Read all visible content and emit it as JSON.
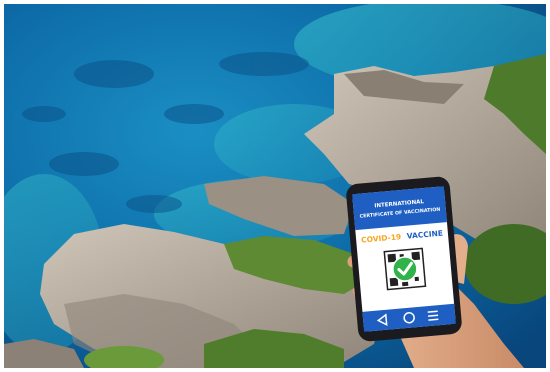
{
  "scene": {
    "sea_deep_color": "#0a4f86",
    "sea_shallow_color": "#2fb5c8",
    "rock_color": "#b8ada0",
    "vegetation_color": "#5e8a34",
    "skin_color": "#e1ab86"
  },
  "phone": {
    "header_line1": "INTERNATIONAL",
    "header_line2": "CERTIFICATE OF VACCINATION",
    "title_prefix": "COVID-19",
    "title_suffix": "VACCINE",
    "header_color": "#1f5fc4",
    "accent_color": "#f5a623",
    "check_color": "#2fb34a",
    "status_icon": "check-circle-icon",
    "nav_icons": [
      "back-triangle-icon",
      "home-circle-icon",
      "menu-lines-icon"
    ]
  }
}
